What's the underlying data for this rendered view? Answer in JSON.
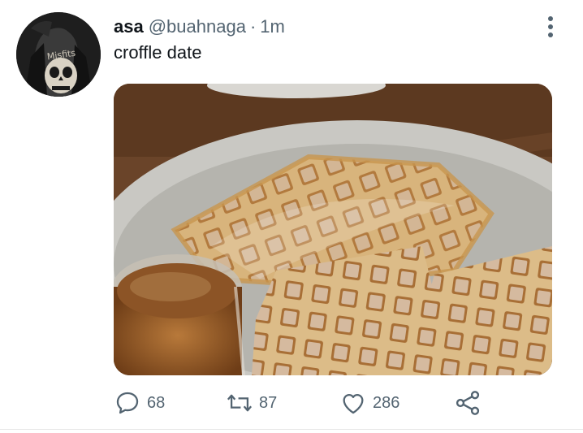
{
  "tweet": {
    "author_name": "asa",
    "author_handle": "@buahnaga",
    "separator": "·",
    "timestamp": "1m",
    "text": "croffle date",
    "avatar_shirt_text": "Misfits"
  },
  "actions": {
    "reply_count": "68",
    "retweet_count": "87",
    "like_count": "286"
  },
  "icons": {
    "reply": "speech-bubble-icon",
    "retweet": "retweet-arrows-icon",
    "like": "heart-outline-icon",
    "share": "share-nodes-icon",
    "more": "vertical-ellipsis-icon"
  },
  "colors": {
    "text_primary": "#0f1419",
    "text_secondary": "#536471",
    "divider": "#e6e6e6"
  }
}
